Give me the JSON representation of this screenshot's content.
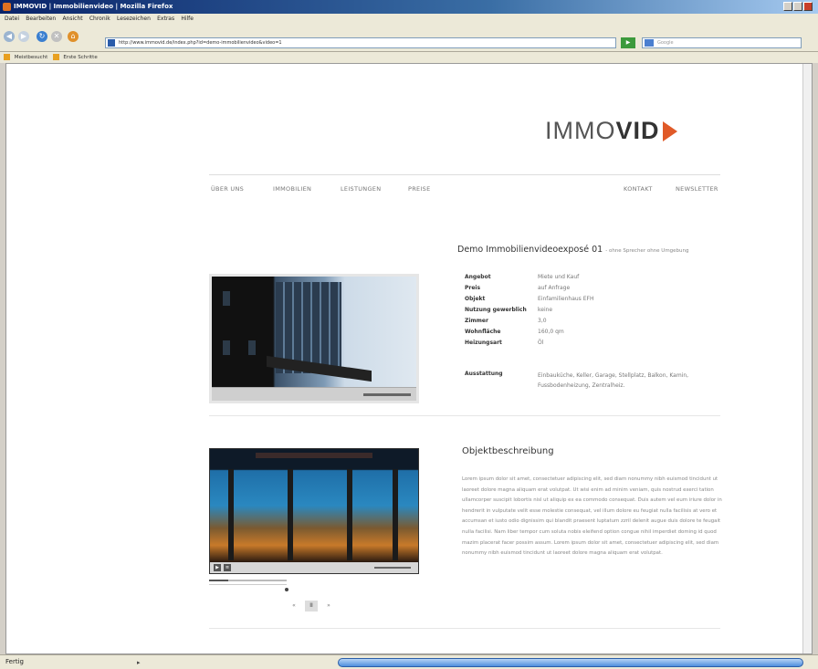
{
  "window": {
    "title": "IMMOVID | Immobilienvideo | Mozilla Firefox"
  },
  "menubar": {
    "items": [
      "Datei",
      "Bearbeiten",
      "Ansicht",
      "Chronik",
      "Lesezeichen",
      "Extras",
      "Hilfe"
    ]
  },
  "toolbar": {
    "address": "http://www.immovid.de/index.php?id=demo-immobilienvideo&video=1",
    "search_placeholder": "Google"
  },
  "bookmarks": {
    "items": [
      "Meistbesucht",
      "Erste Schritte"
    ]
  },
  "logo": {
    "light": "IMMO",
    "bold": "VID"
  },
  "nav": {
    "left": [
      "ÜBER UNS",
      "IMMOBILIEN",
      "LEISTUNGEN",
      "PREISE"
    ],
    "right": [
      "KONTAKT",
      "NEWSLETTER"
    ]
  },
  "listing": {
    "title": "Demo Immobilienvideoexposé 01",
    "subtitle": "- ohne Sprecher ohne Umgebung",
    "details": [
      {
        "key": "Angebot",
        "value": "Miete und Kauf"
      },
      {
        "key": "Preis",
        "value": "auf Anfrage"
      },
      {
        "key": "Objekt",
        "value": "Einfamilienhaus EFH"
      },
      {
        "key": "Nutzung gewerblich",
        "value": "keine"
      },
      {
        "key": "Zimmer",
        "value": "3,0"
      },
      {
        "key": "Wohnfläche",
        "value": "160,0 qm"
      },
      {
        "key": "Heizungsart",
        "value": "Öl"
      },
      {
        "key": "Ausstattung",
        "value": "Einbauküche, Keller, Garage, Stellplatz, Balkon, Kamin, Fussbodenheizung, Zentralheiz."
      }
    ]
  },
  "description": {
    "title": "Objektbeschreibung",
    "text": "Lorem ipsum dolor sit amet, consectetuer adipiscing elit, sed diam nonummy nibh euismod tincidunt ut laoreet dolore magna aliquam erat volutpat. Ut wisi enim ad minim veniam, quis nostrud exerci tation ullamcorper suscipit lobortis nisl ut aliquip ex ea commodo consequat. Duis autem vel eum iriure dolor in hendrerit in vulputate velit esse molestie consequat, vel illum dolore eu feugiat nulla facilisis at vero et accumsan et iusto odio dignissim qui blandit praesent luptatum zzril delenit augue duis dolore te feugait nulla facilisi. Nam liber tempor cum soluta nobis eleifend option congue nihil imperdiet doming id quod mazim placerat facer possim assum. Lorem ipsum dolor sit amet, consectetuer adipiscing elit, sed diam nonummy nibh euismod tincidunt ut laoreet dolore magna aliquam erat volutpat."
  },
  "pager": {
    "prev": "«",
    "current": "II",
    "next": "»"
  },
  "player": {
    "play": "▶",
    "vol": "≡",
    "progress_fraction": 0.25
  },
  "status": {
    "text": "Fertig"
  },
  "colors": {
    "accent": "#e05a28",
    "link": "#777777"
  }
}
